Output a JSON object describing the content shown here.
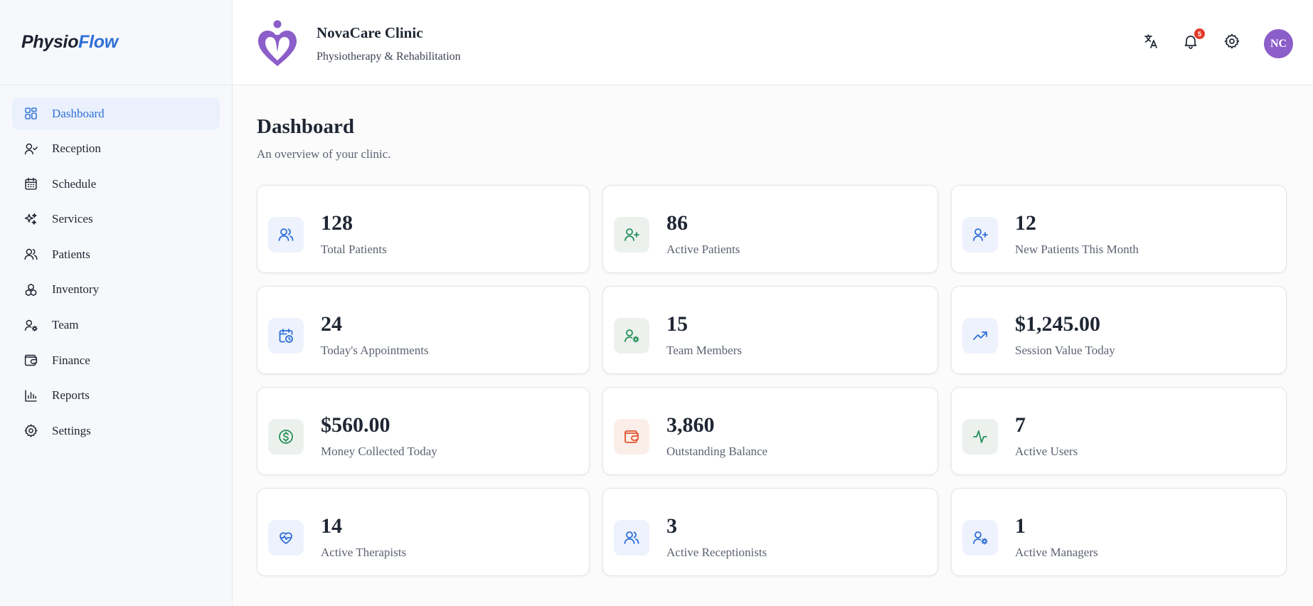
{
  "brand": {
    "part1": "Physio",
    "part2": "Flow"
  },
  "sidebar": {
    "items": [
      {
        "label": "Dashboard",
        "icon": "dashboard-icon",
        "active": true
      },
      {
        "label": "Reception",
        "icon": "user-check-icon"
      },
      {
        "label": "Schedule",
        "icon": "calendar-icon"
      },
      {
        "label": "Services",
        "icon": "sparkles-icon"
      },
      {
        "label": "Patients",
        "icon": "users-icon"
      },
      {
        "label": "Inventory",
        "icon": "boxes-icon"
      },
      {
        "label": "Team",
        "icon": "user-cog-icon"
      },
      {
        "label": "Finance",
        "icon": "wallet-icon"
      },
      {
        "label": "Reports",
        "icon": "bar-chart-icon"
      },
      {
        "label": "Settings",
        "icon": "gear-icon"
      }
    ]
  },
  "header": {
    "clinic_name": "NovaCare Clinic",
    "clinic_subtitle": "Physiotherapy & Rehabilitation",
    "notification_count": "5",
    "avatar_initials": "NC"
  },
  "page": {
    "title": "Dashboard",
    "subtitle": "An overview of your clinic."
  },
  "stats": [
    {
      "value": "128",
      "label": "Total Patients",
      "icon": "users-icon",
      "tone": "blue"
    },
    {
      "value": "86",
      "label": "Active Patients",
      "icon": "user-plus-icon",
      "tone": "green"
    },
    {
      "value": "12",
      "label": "New Patients This Month",
      "icon": "user-plus-icon",
      "tone": "blue"
    },
    {
      "value": "24",
      "label": "Today's Appointments",
      "icon": "calendar-clock-icon",
      "tone": "blue"
    },
    {
      "value": "15",
      "label": "Team Members",
      "icon": "user-cog-icon",
      "tone": "green"
    },
    {
      "value": "$1,245.00",
      "label": "Session Value Today",
      "icon": "trending-up-icon",
      "tone": "blue"
    },
    {
      "value": "$560.00",
      "label": "Money Collected Today",
      "icon": "dollar-circle-icon",
      "tone": "green"
    },
    {
      "value": "3,860",
      "label": "Outstanding Balance",
      "icon": "wallet-icon",
      "tone": "orange"
    },
    {
      "value": "7",
      "label": "Active Users",
      "icon": "activity-icon",
      "tone": "green"
    },
    {
      "value": "14",
      "label": "Active Therapists",
      "icon": "heart-pulse-icon",
      "tone": "blue"
    },
    {
      "value": "3",
      "label": "Active Receptionists",
      "icon": "users-icon",
      "tone": "blue"
    },
    {
      "value": "1",
      "label": "Active Managers",
      "icon": "user-cog-icon",
      "tone": "blue"
    }
  ],
  "colors": {
    "accent": "#2f6fd6",
    "success": "#25925a",
    "warning": "#e0542f",
    "brand_purple": "#8b5ec9"
  }
}
